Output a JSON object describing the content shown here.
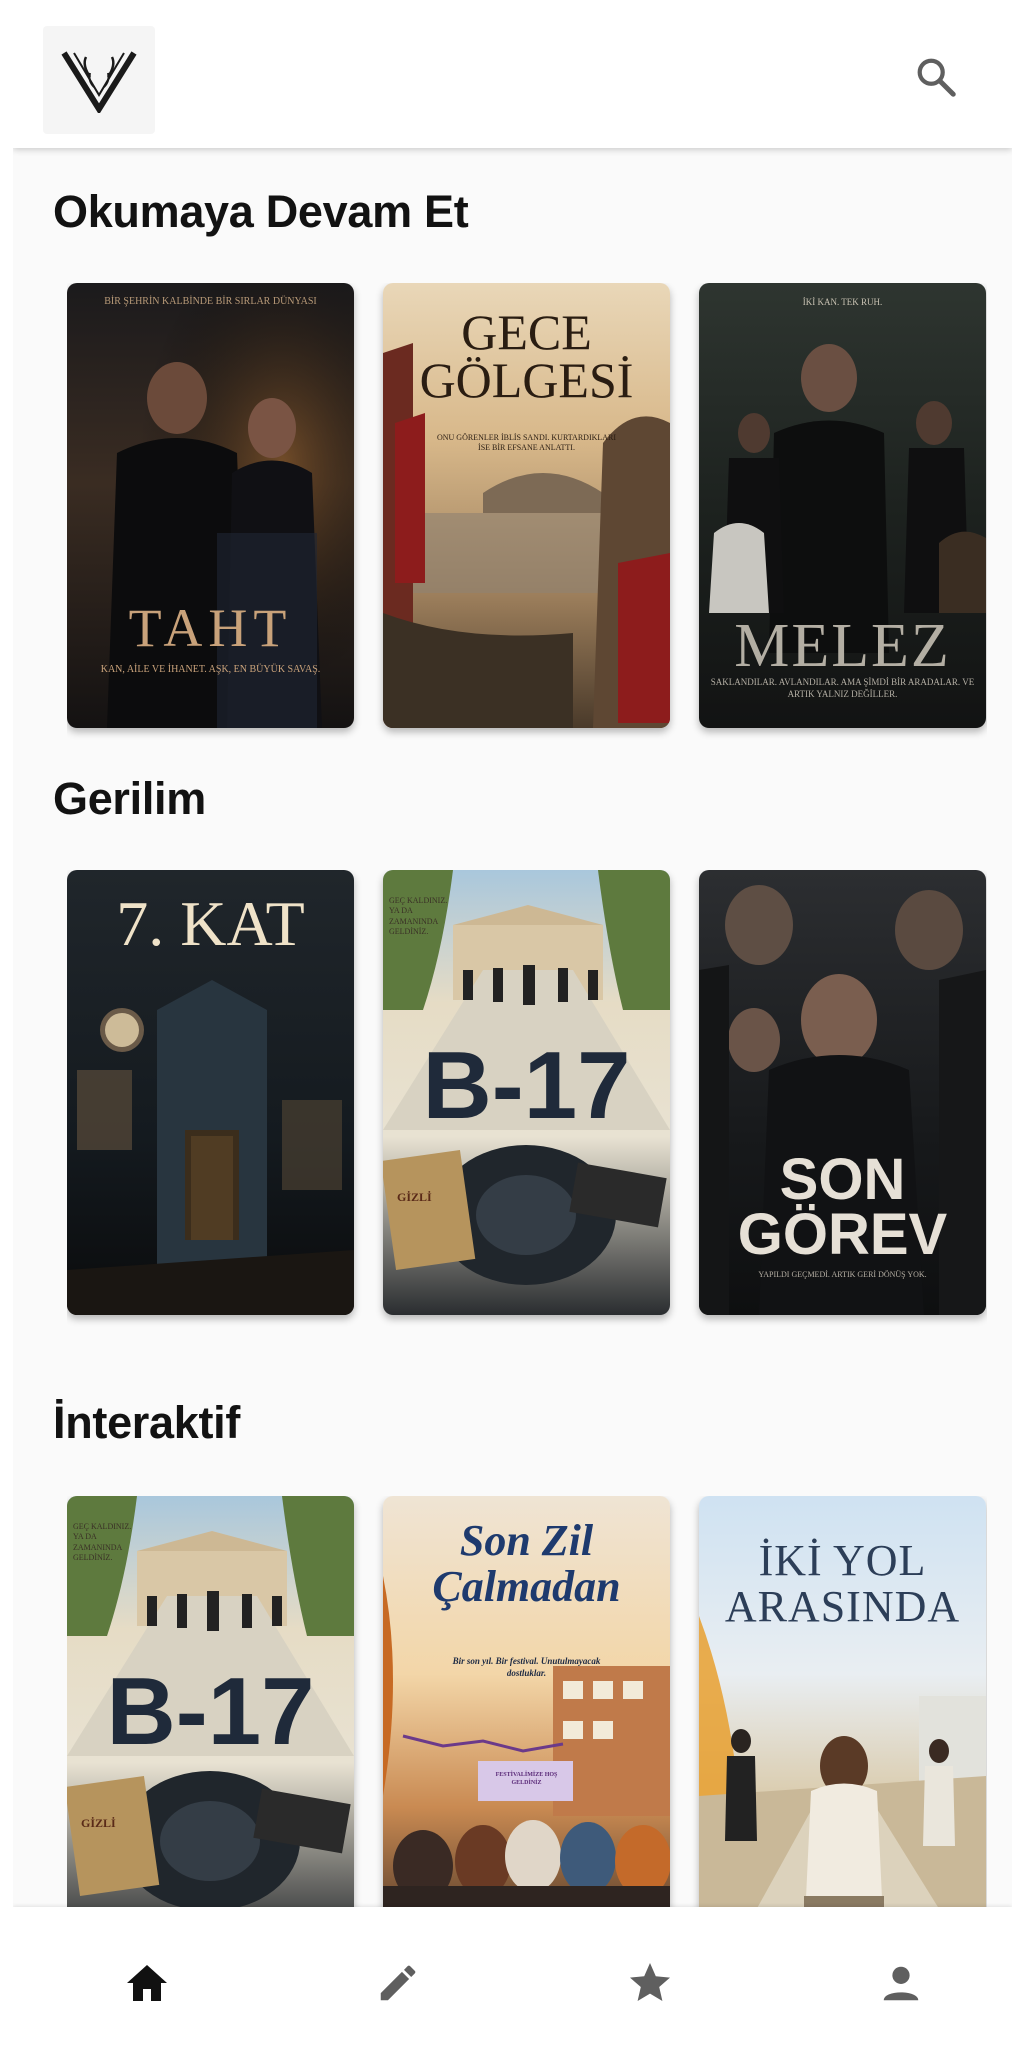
{
  "header": {
    "logo_icon": "v-wings-logo",
    "search_icon": "search-icon"
  },
  "sections": [
    {
      "title": "Okumaya Devam Et",
      "books": [
        {
          "title": "TAHT",
          "tagline": "KAN, AİLE VE İHANET. AŞK, EN BÜYÜK SAVAŞ.",
          "top_text": "BİR ŞEHRİN KALBİNDE BİR SIRLAR DÜNYASI"
        },
        {
          "title": "GECE GÖLGESİ",
          "tagline": "ONU GÖRENLER İBLİS SANDI. KURTARDIKLARI İSE BİR EFSANE ANLATTI.",
          "top_text": ""
        },
        {
          "title": "MELEZ",
          "tagline": "SAKLANDILAR. AVLANDILAR. AMA ŞİMDİ BİR ARADALAR. VE ARTIK YALNIZ DEĞİLLER.",
          "top_text": "İKİ KAN. TEK RUH."
        }
      ]
    },
    {
      "title": "Gerilim",
      "books": [
        {
          "title": "7. KAT",
          "tagline": "",
          "top_text": ""
        },
        {
          "title": "B-17",
          "tagline": "GİZLİ",
          "top_text": "GEÇ KALDINIZ. YA DA ZAMANINDA GELDİNİZ."
        },
        {
          "title": "SON GÖREV",
          "tagline": "YAPILDI GEÇMEDİ. ARTIK GERİ DÖNÜŞ YOK.",
          "top_text": ""
        }
      ]
    },
    {
      "title": "İnteraktif",
      "books": [
        {
          "title": "B-17",
          "tagline": "GİZLİ",
          "top_text": "GEÇ KALDINIZ. YA DA ZAMANINDA GELDİNİZ."
        },
        {
          "title": "Son Zil Çalmadan",
          "tagline": "Bir son yıl. Bir festival. Unutulmayacak dostluklar.",
          "top_text": "FESTİVALİMİZE HOŞ GELDİNİZ"
        },
        {
          "title": "İKİ YOL ARASINDA",
          "tagline": "",
          "top_text": ""
        }
      ]
    }
  ],
  "bottom_nav": [
    {
      "icon": "home-icon",
      "active": true
    },
    {
      "icon": "pencil-icon",
      "active": false
    },
    {
      "icon": "star-icon",
      "active": false
    },
    {
      "icon": "profile-icon",
      "active": false
    }
  ],
  "colors": {
    "active_icon": "#111111",
    "inactive_icon": "#5f5f5f",
    "title_text": "#121212"
  }
}
